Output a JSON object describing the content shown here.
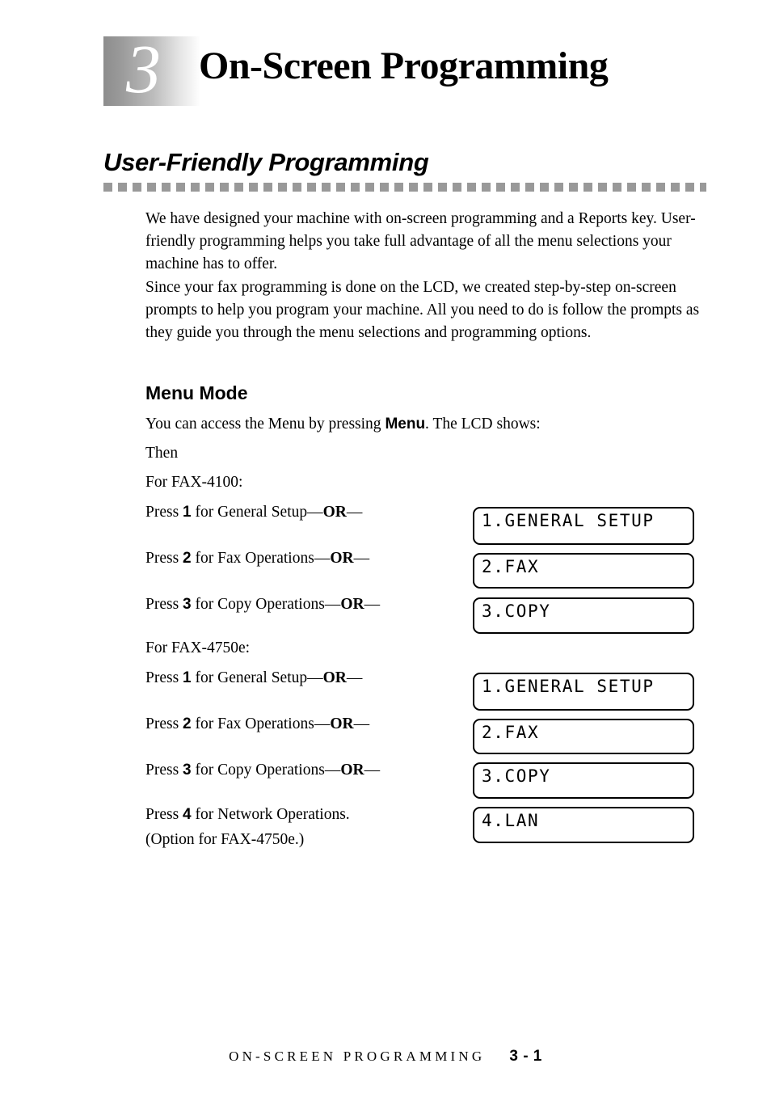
{
  "chapter": {
    "number": "3",
    "title": "On-Screen Programming"
  },
  "section": {
    "heading": "User-Friendly Programming"
  },
  "paragraphs": [
    "We have designed your machine with on-screen programming and a Reports key. User-friendly programming helps you take full advantage of all the menu selections your machine has to offer.",
    "Since your fax programming is done on the LCD, we created step-by-step on-screen prompts to help you program your machine.  All you need to do is follow the prompts as they guide you through the menu selections and programming options."
  ],
  "menu_mode": {
    "heading": "Menu Mode",
    "intro_prefix": "You can access the Menu by pressing ",
    "intro_key": "Menu",
    "intro_suffix": ". The LCD shows:",
    "then_label": "Then"
  },
  "model_4100": {
    "label": "For FAX-4100:",
    "steps": [
      {
        "press": "Press ",
        "key": "1",
        "text": " for General Setup",
        "dash_before": "—",
        "or": "OR",
        "dash_after": "—"
      },
      {
        "press": "Press ",
        "key": "2",
        "text": " for Fax Operations",
        "dash_before": "—",
        "or": "OR",
        "dash_after": "—"
      },
      {
        "press": "Press ",
        "key": "3",
        "text": " for Copy Operations",
        "dash_before": "—",
        "or": "OR",
        "dash_after": "—"
      }
    ],
    "lcd_screens": [
      "1.GENERAL SETUP",
      "2.FAX",
      "3.COPY"
    ]
  },
  "model_4750e": {
    "label": "For FAX-4750e:",
    "steps": [
      {
        "press": "Press ",
        "key": "1",
        "text": " for General Setup",
        "dash_before": "—",
        "or": "OR",
        "dash_after": "—"
      },
      {
        "press": "Press ",
        "key": "2",
        "text": " for Fax Operations",
        "dash_before": "—",
        "or": "OR",
        "dash_after": "—"
      },
      {
        "press": "Press ",
        "key": "3",
        "text": " for Copy Operations",
        "dash_before": "—",
        "or": "OR",
        "dash_after": "—"
      },
      {
        "press": "Press ",
        "key": "4",
        "text": " for Network Operations.",
        "dash_before": "",
        "or": "",
        "dash_after": ""
      }
    ],
    "note": "(Option for FAX-4750e.)",
    "lcd_screens": [
      "1.GENERAL SETUP",
      "2.FAX",
      "3.COPY",
      "4.LAN"
    ]
  },
  "footer": {
    "title": "ON-SCREEN PROGRAMMING",
    "page": "3 - 1"
  },
  "colors": {
    "rule_gray": "#999999",
    "gradient_start": "#8d8d8d",
    "gradient_end": "#ffffff",
    "text": "#000000"
  }
}
